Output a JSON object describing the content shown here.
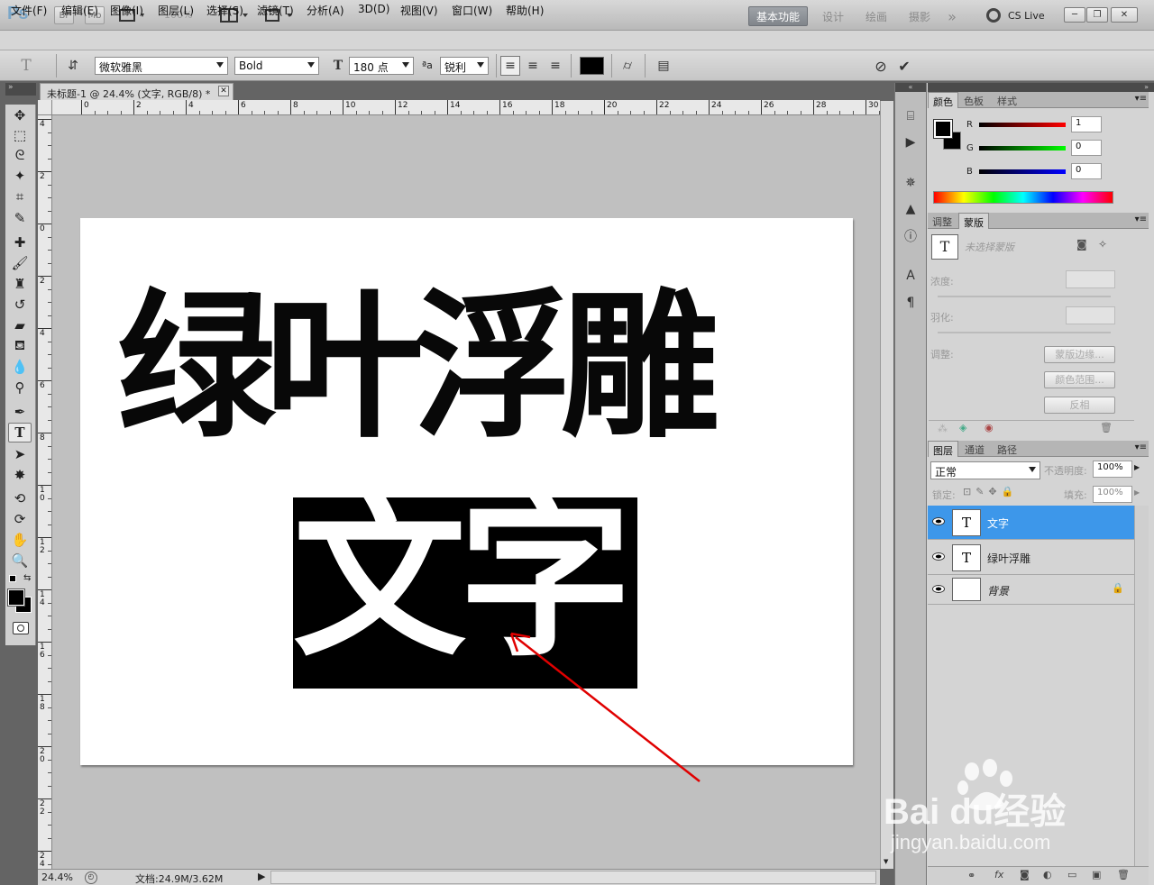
{
  "app": {
    "logo": "Ps",
    "bridge": "Br",
    "mini": "Mb",
    "zoom_pct": "100%"
  },
  "workspaces": [
    "基本功能",
    "设计",
    "绘画",
    "摄影"
  ],
  "workspace_more": "»",
  "cslive": "CS Live",
  "menu": [
    "文件(F)",
    "编辑(E)",
    "图像(I)",
    "图层(L)",
    "选择(S)",
    "滤镜(T)",
    "分析(A)",
    "3D(D)",
    "视图(V)",
    "窗口(W)",
    "帮助(H)"
  ],
  "options": {
    "font_family": "微软雅黑",
    "font_style": "Bold",
    "font_size": "180 点",
    "aa_label": "ªa",
    "aa_mode": "锐利",
    "color": "#000000"
  },
  "document": {
    "tab_title": "未标题-1 @ 24.4% (文字, RGB/8) *",
    "heading_text": "绿叶浮雕",
    "selected_text": "文字"
  },
  "ruler": {
    "h_labels": [
      "0",
      "2",
      "4",
      "6",
      "8",
      "10",
      "12",
      "14",
      "16",
      "18",
      "20",
      "22",
      "24",
      "26",
      "28",
      "30"
    ],
    "v_labels": [
      "4",
      "2",
      "0",
      "2",
      "4",
      "6",
      "8",
      "1 0",
      "1 2",
      "1 4",
      "1 6",
      "1 8",
      "2 0",
      "2 2",
      "2 4"
    ]
  },
  "status": {
    "zoom": "24.4%",
    "doc_info": "文档:24.9M/3.62M"
  },
  "color_panel": {
    "tabs": [
      "颜色",
      "色板",
      "样式"
    ],
    "channels": [
      {
        "name": "R",
        "value": "1"
      },
      {
        "name": "G",
        "value": "0"
      },
      {
        "name": "B",
        "value": "0"
      }
    ]
  },
  "masks_panel": {
    "tabs": [
      "调整",
      "蒙版"
    ],
    "no_mask": "未选择蒙版",
    "density": "浓度:",
    "feather": "羽化:",
    "refine": "调整:",
    "buttons": [
      "蒙版边缘...",
      "颜色范围...",
      "反相"
    ]
  },
  "layers_panel": {
    "tabs": [
      "图层",
      "通道",
      "路径"
    ],
    "blend": "正常",
    "opacity_label": "不透明度:",
    "opacity": "100%",
    "lock_label": "锁定:",
    "fill_label": "填充:",
    "fill": "100%",
    "layers": [
      {
        "name": "文字",
        "thumb": "T",
        "selected": true
      },
      {
        "name": "绿叶浮雕",
        "thumb": "T",
        "selected": false
      },
      {
        "name": "背景",
        "thumb": "",
        "selected": false
      }
    ]
  },
  "watermark": {
    "brand": "Bai  du经验",
    "url": "jingyan.baidu.com"
  }
}
